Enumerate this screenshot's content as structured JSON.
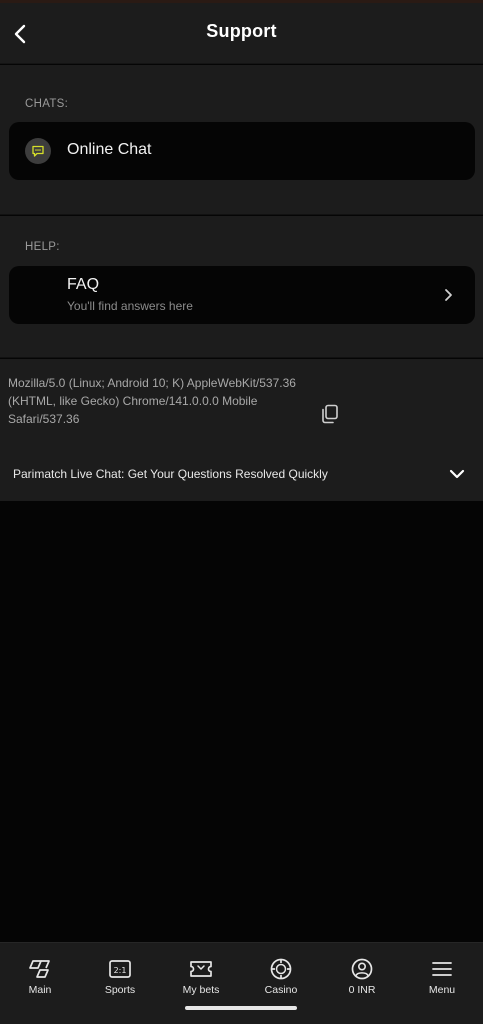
{
  "header": {
    "title": "Support"
  },
  "chats": {
    "label": "CHATS:",
    "items": [
      {
        "title": "Online Chat",
        "icon": "chat-bubble-icon"
      }
    ]
  },
  "help": {
    "label": "HELP:",
    "items": [
      {
        "title": "FAQ",
        "subtitle": "You'll find answers here"
      }
    ]
  },
  "info": {
    "user_agent": "Mozilla/5.0 (Linux; Android 10; K) AppleWebKit/537.36 (KHTML, like Gecko) Chrome/141.0.0.0 Mobile Safari/537.36",
    "accordion_title": "Parimatch Live Chat: Get Your Questions Resolved Quickly"
  },
  "nav": {
    "items": [
      {
        "label": "Main",
        "icon": "main-icon"
      },
      {
        "label": "Sports",
        "icon": "sports-icon"
      },
      {
        "label": "My bets",
        "icon": "ticket-icon"
      },
      {
        "label": "Casino",
        "icon": "casino-chip-icon"
      },
      {
        "label": "0 INR",
        "icon": "account-icon"
      },
      {
        "label": "Menu",
        "icon": "hamburger-icon"
      }
    ],
    "sports_icon_text": "2:1"
  },
  "colors": {
    "background": "#050505",
    "surface": "#1c1c1c",
    "accent": "#d6e02a",
    "text_muted": "#9a9a9a"
  }
}
